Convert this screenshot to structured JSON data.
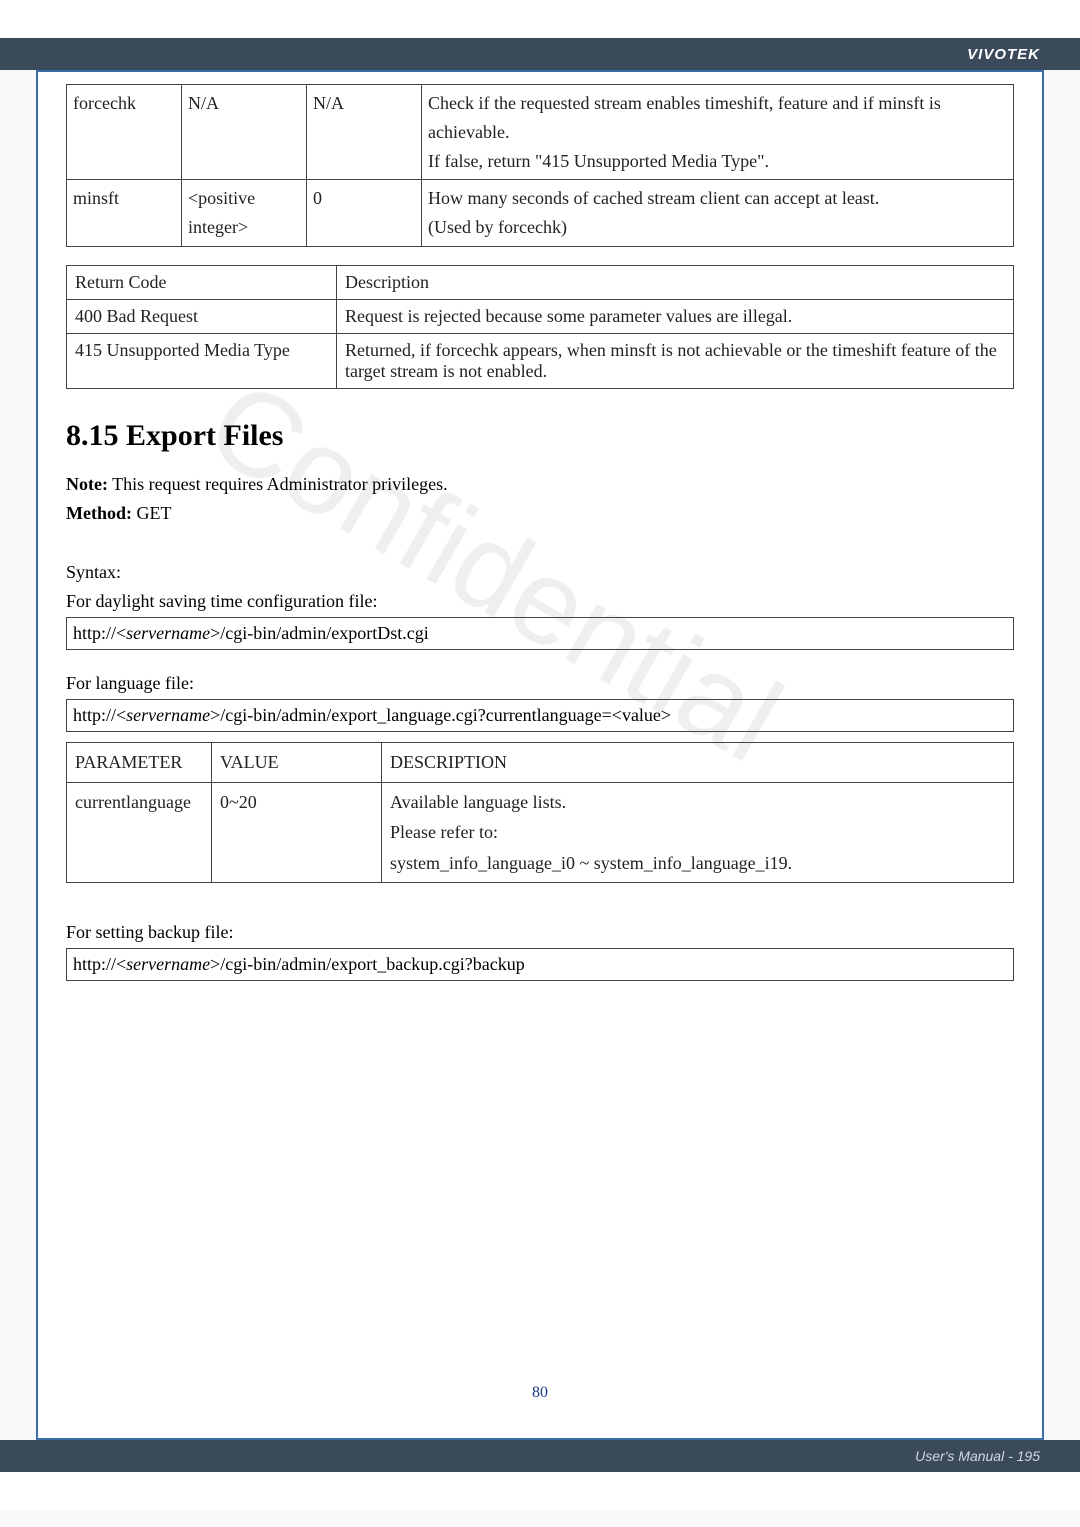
{
  "header": {
    "brand": "VIVOTEK"
  },
  "footer": {
    "manual_text": "User's Manual - 195"
  },
  "page_number": "80",
  "watermark": "Confidential",
  "params_table": {
    "rows": [
      {
        "name": "forcechk",
        "value": "N/A",
        "default": "N/A",
        "desc": "Check if the requested stream enables timeshift, feature and   if minsft is achievable.\nIf false, return \"415 Unsupported Media Type\"."
      },
      {
        "name": "minsft",
        "value": "<positive integer>",
        "default": "0",
        "desc": "How many seconds of cached stream client can accept at least.\n(Used by forcechk)"
      }
    ]
  },
  "return_table": {
    "headers": {
      "code": "Return Code",
      "desc": "Description"
    },
    "rows": [
      {
        "code": "400 Bad Request",
        "desc": "Request is rejected because some parameter values are illegal."
      },
      {
        "code": "415 Unsupported Media Type",
        "desc": "Returned, if forcechk appears, when minsft is not achievable or the timeshift feature of the target stream is not enabled."
      }
    ]
  },
  "section": {
    "title": "8.15 Export Files",
    "note_label": "Note:",
    "note_text": " This request requires Administrator privileges.",
    "method_label": "Method:",
    "method_value": " GET",
    "syntax_label": "Syntax:",
    "dst_label": "For daylight saving time configuration file:",
    "dst_url_pre": "http://<",
    "dst_url_server": "servername",
    "dst_url_post": ">/cgi-bin/admin/exportDst.cgi",
    "lang_label": "For language file:",
    "lang_url_pre": "http://<",
    "lang_url_server": "servername",
    "lang_url_post": ">/cgi-bin/admin/export_language.cgi?currentlanguage=<value>",
    "backup_label": "For setting backup file:",
    "backup_url_pre": "http://<",
    "backup_url_server": "servername",
    "backup_url_post": ">/cgi-bin/admin/export_backup.cgi?backup"
  },
  "lang_table": {
    "headers": {
      "param": "PARAMETER",
      "value": "VALUE",
      "desc": "DESCRIPTION"
    },
    "row": {
      "param": "currentlanguage",
      "value": "0~20",
      "desc": "Available language lists.\nPlease refer to:\nsystem_info_language_i0 ~ system_info_language_i19."
    }
  }
}
